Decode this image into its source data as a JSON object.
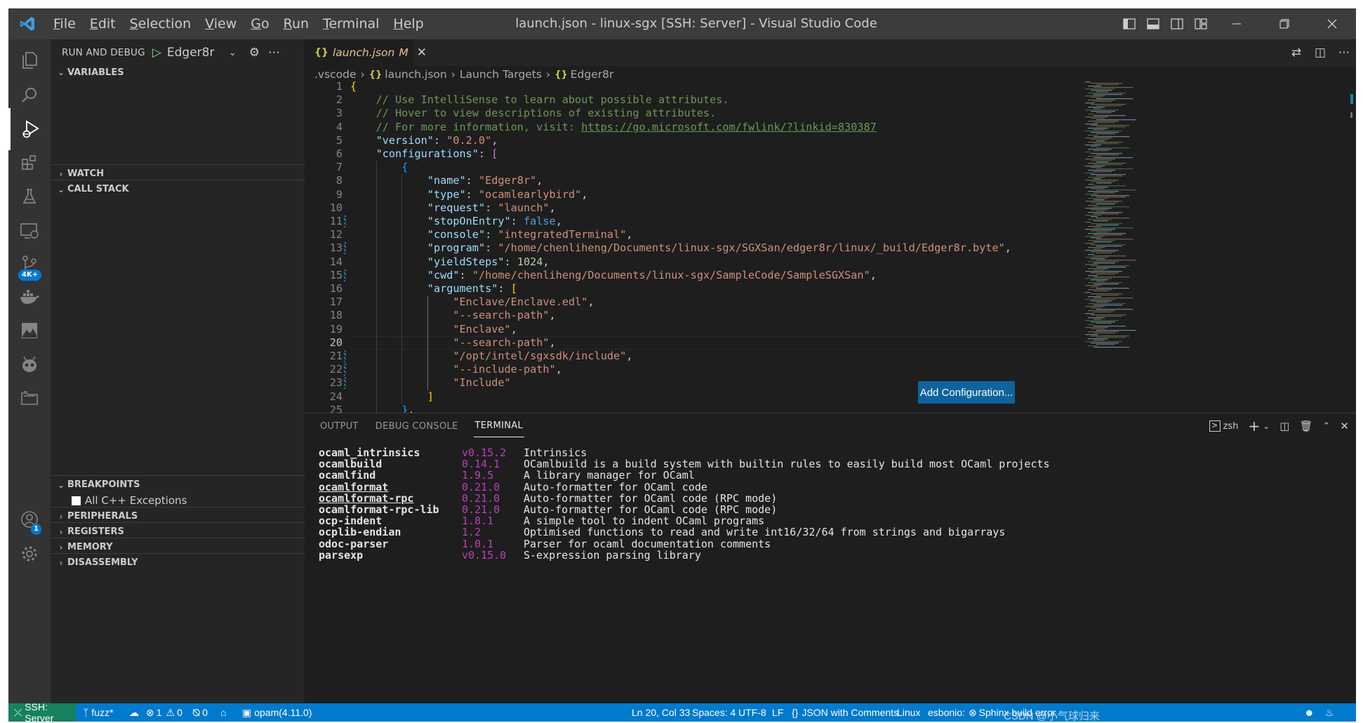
{
  "window": {
    "title": "launch.json - linux-sgx [SSH: Server] - Visual Studio Code",
    "menu": [
      "File",
      "Edit",
      "Selection",
      "View",
      "Go",
      "Run",
      "Terminal",
      "Help"
    ],
    "menu_mnemonic": [
      "F",
      "E",
      "S",
      "V",
      "G",
      "R",
      "T",
      "H"
    ],
    "menu_rest": [
      "ile",
      "dit",
      "election",
      "iew",
      "o",
      "un",
      "erminal",
      "elp"
    ]
  },
  "activity": {
    "remote_badge": "4K+",
    "accounts_badge": "1"
  },
  "sidebar": {
    "title": "RUN AND DEBUG",
    "config": "Edger8r",
    "sections": {
      "variables": "VARIABLES",
      "watch": "WATCH",
      "call_stack": "CALL STACK",
      "breakpoints": "BREAKPOINTS",
      "peripherals": "PERIPHERALS",
      "registers": "REGISTERS",
      "memory": "MEMORY",
      "disassembly": "DISASSEMBLY"
    },
    "breakpoint_item": "All C++ Exceptions"
  },
  "editor": {
    "tab": {
      "name": "launch.json",
      "modified": "M"
    },
    "breadcrumb": [
      ".vscode",
      "launch.json",
      "Launch Targets",
      "Edger8r"
    ],
    "lines": [
      {
        "n": "1",
        "indent": 0,
        "tokens": [
          [
            "b1",
            "{"
          ]
        ]
      },
      {
        "n": "2",
        "indent": 1,
        "tokens": [
          [
            "com",
            "// Use IntelliSense to learn about possible attributes."
          ]
        ]
      },
      {
        "n": "3",
        "indent": 1,
        "tokens": [
          [
            "com",
            "// Hover to view descriptions of existing attributes."
          ]
        ]
      },
      {
        "n": "4",
        "indent": 1,
        "tokens": [
          [
            "com",
            "// For more information, visit: "
          ],
          [
            "link",
            "https://go.microsoft.com/fwlink/?linkid=830387"
          ]
        ]
      },
      {
        "n": "5",
        "indent": 1,
        "tokens": [
          [
            "key",
            "\"version\""
          ],
          [
            "pun",
            ": "
          ],
          [
            "str",
            "\"0.2.0\""
          ],
          [
            "pun",
            ","
          ]
        ]
      },
      {
        "n": "6",
        "indent": 1,
        "tokens": [
          [
            "key",
            "\"configurations\""
          ],
          [
            "pun",
            ": "
          ],
          [
            "b2",
            "["
          ]
        ]
      },
      {
        "n": "7",
        "indent": 2,
        "tokens": [
          [
            "b3",
            "{"
          ]
        ]
      },
      {
        "n": "8",
        "indent": 3,
        "tokens": [
          [
            "key",
            "\"name\""
          ],
          [
            "pun",
            ": "
          ],
          [
            "str",
            "\"Edger8r\""
          ],
          [
            "pun",
            ","
          ]
        ]
      },
      {
        "n": "9",
        "indent": 3,
        "tokens": [
          [
            "key",
            "\"type\""
          ],
          [
            "pun",
            ": "
          ],
          [
            "str",
            "\"ocamlearlybird\""
          ],
          [
            "pun",
            ","
          ]
        ]
      },
      {
        "n": "10",
        "indent": 3,
        "tokens": [
          [
            "key",
            "\"request\""
          ],
          [
            "pun",
            ": "
          ],
          [
            "str",
            "\"launch\""
          ],
          [
            "pun",
            ","
          ]
        ]
      },
      {
        "n": "11",
        "indent": 3,
        "tokens": [
          [
            "key",
            "\"stopOnEntry\""
          ],
          [
            "pun",
            ": "
          ],
          [
            "bool",
            "false"
          ],
          [
            "pun",
            ","
          ]
        ]
      },
      {
        "n": "12",
        "indent": 3,
        "tokens": [
          [
            "key",
            "\"console\""
          ],
          [
            "pun",
            ": "
          ],
          [
            "str",
            "\"integratedTerminal\""
          ],
          [
            "pun",
            ","
          ]
        ]
      },
      {
        "n": "13",
        "indent": 3,
        "tokens": [
          [
            "key",
            "\"program\""
          ],
          [
            "pun",
            ": "
          ],
          [
            "str",
            "\"/home/chenliheng/Documents/linux-sgx/SGXSan/edger8r/linux/_build/Edger8r.byte\""
          ],
          [
            "pun",
            ","
          ]
        ]
      },
      {
        "n": "14",
        "indent": 3,
        "tokens": [
          [
            "key",
            "\"yieldSteps\""
          ],
          [
            "pun",
            ": "
          ],
          [
            "num",
            "1024"
          ],
          [
            "pun",
            ","
          ]
        ]
      },
      {
        "n": "15",
        "indent": 3,
        "tokens": [
          [
            "key",
            "\"cwd\""
          ],
          [
            "pun",
            ": "
          ],
          [
            "str",
            "\"/home/chenliheng/Documents/linux-sgx/SampleCode/SampleSGXSan\""
          ],
          [
            "pun",
            ","
          ]
        ]
      },
      {
        "n": "16",
        "indent": 3,
        "tokens": [
          [
            "key",
            "\"arguments\""
          ],
          [
            "pun",
            ": "
          ],
          [
            "b1",
            "["
          ]
        ]
      },
      {
        "n": "17",
        "indent": 4,
        "tokens": [
          [
            "str",
            "\"Enclave/Enclave.edl\""
          ],
          [
            "pun",
            ","
          ]
        ]
      },
      {
        "n": "18",
        "indent": 4,
        "tokens": [
          [
            "str",
            "\"--search-path\""
          ],
          [
            "pun",
            ","
          ]
        ]
      },
      {
        "n": "19",
        "indent": 4,
        "tokens": [
          [
            "str",
            "\"Enclave\""
          ],
          [
            "pun",
            ","
          ]
        ]
      },
      {
        "n": "20",
        "indent": 4,
        "tokens": [
          [
            "str",
            "\"--search-path\""
          ],
          [
            "pun",
            ","
          ]
        ]
      },
      {
        "n": "21",
        "indent": 4,
        "tokens": [
          [
            "str",
            "\"/opt/intel/sgxsdk/include\""
          ],
          [
            "pun",
            ","
          ]
        ]
      },
      {
        "n": "22",
        "indent": 4,
        "tokens": [
          [
            "str",
            "\"--include-path\""
          ],
          [
            "pun",
            ","
          ]
        ]
      },
      {
        "n": "23",
        "indent": 4,
        "tokens": [
          [
            "str",
            "\"Include\""
          ]
        ]
      },
      {
        "n": "24",
        "indent": 3,
        "tokens": [
          [
            "b1",
            "]"
          ]
        ]
      },
      {
        "n": "25",
        "indent": 2,
        "tokens": [
          [
            "b3",
            "}"
          ],
          [
            "pun",
            ","
          ]
        ]
      }
    ],
    "current_line": "20",
    "gutter_marks": [
      "11",
      "13",
      "15",
      "21",
      "22",
      "23"
    ],
    "add_configuration_label": "Add Configuration..."
  },
  "panel": {
    "tabs": [
      "OUTPUT",
      "DEBUG CONSOLE",
      "TERMINAL"
    ],
    "active_tab": "TERMINAL",
    "shell": "zsh",
    "terminal_rows": [
      {
        "name": "ocaml_intrinsics",
        "version": "v0.15.2",
        "desc": "Intrinsics",
        "underline": false
      },
      {
        "name": "ocamlbuild",
        "version": "0.14.1",
        "desc": "OCamlbuild is a build system with builtin rules to easily build most OCaml projects",
        "underline": false
      },
      {
        "name": "ocamlfind",
        "version": "1.9.5",
        "desc": "A library manager for OCaml",
        "underline": false
      },
      {
        "name": "ocamlformat",
        "version": "0.21.0",
        "desc": "Auto-formatter for OCaml code",
        "underline": true
      },
      {
        "name": "ocamlformat-rpc",
        "version": "0.21.0",
        "desc": "Auto-formatter for OCaml code (RPC mode)",
        "underline": true
      },
      {
        "name": "ocamlformat-rpc-lib",
        "version": "0.21.0",
        "desc": "Auto-formatter for OCaml code (RPC mode)",
        "underline": false
      },
      {
        "name": "ocp-indent",
        "version": "1.8.1",
        "desc": "A simple tool to indent OCaml programs",
        "underline": false
      },
      {
        "name": "ocplib-endian",
        "version": "1.2",
        "desc": "Optimised functions to read and write int16/32/64 from strings and bigarrays",
        "underline": false
      },
      {
        "name": "odoc-parser",
        "version": "1.0.1",
        "desc": "Parser for ocaml documentation comments",
        "underline": false
      },
      {
        "name": "parsexp",
        "version": "v0.15.0",
        "desc": "S-expression parsing library",
        "underline": false
      }
    ]
  },
  "statusbar": {
    "remote": "SSH: Server",
    "branch": "fuzz*",
    "errors": "1",
    "warnings": "0",
    "ports": "0",
    "opam": "opam(4.11.0)",
    "cursor": "Ln 20, Col 33",
    "spaces": "Spaces: 4",
    "encoding": "UTF-8",
    "eol": "LF",
    "language": "JSON with Comments",
    "os": "Linux",
    "esbonio": "esbonio:",
    "sphinx": "Sphinx build error"
  },
  "watermark": "CSDN @小气球归来",
  "colors": {
    "accent": "#007acc",
    "remote": "#16825d",
    "button": "#0e639c",
    "editor_bg": "#1e1e1e",
    "sidebar_bg": "#252526",
    "activity_bg": "#333333",
    "titlebar_bg": "#3c3c3c"
  }
}
